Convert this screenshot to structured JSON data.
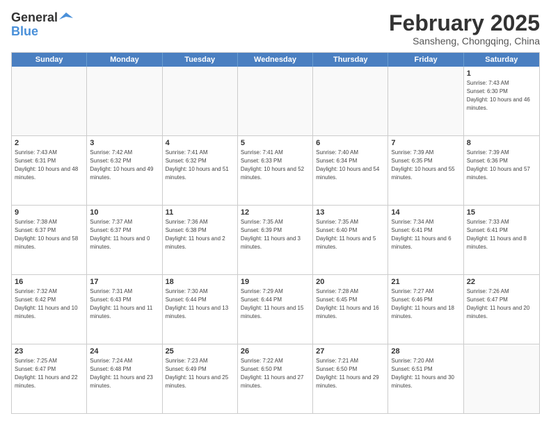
{
  "header": {
    "logo_line1": "General",
    "logo_line2": "Blue",
    "month_title": "February 2025",
    "subtitle": "Sansheng, Chongqing, China"
  },
  "weekdays": [
    "Sunday",
    "Monday",
    "Tuesday",
    "Wednesday",
    "Thursday",
    "Friday",
    "Saturday"
  ],
  "rows": [
    [
      {
        "day": "",
        "text": ""
      },
      {
        "day": "",
        "text": ""
      },
      {
        "day": "",
        "text": ""
      },
      {
        "day": "",
        "text": ""
      },
      {
        "day": "",
        "text": ""
      },
      {
        "day": "",
        "text": ""
      },
      {
        "day": "1",
        "text": "Sunrise: 7:43 AM\nSunset: 6:30 PM\nDaylight: 10 hours and 46 minutes."
      }
    ],
    [
      {
        "day": "2",
        "text": "Sunrise: 7:43 AM\nSunset: 6:31 PM\nDaylight: 10 hours and 48 minutes."
      },
      {
        "day": "3",
        "text": "Sunrise: 7:42 AM\nSunset: 6:32 PM\nDaylight: 10 hours and 49 minutes."
      },
      {
        "day": "4",
        "text": "Sunrise: 7:41 AM\nSunset: 6:32 PM\nDaylight: 10 hours and 51 minutes."
      },
      {
        "day": "5",
        "text": "Sunrise: 7:41 AM\nSunset: 6:33 PM\nDaylight: 10 hours and 52 minutes."
      },
      {
        "day": "6",
        "text": "Sunrise: 7:40 AM\nSunset: 6:34 PM\nDaylight: 10 hours and 54 minutes."
      },
      {
        "day": "7",
        "text": "Sunrise: 7:39 AM\nSunset: 6:35 PM\nDaylight: 10 hours and 55 minutes."
      },
      {
        "day": "8",
        "text": "Sunrise: 7:39 AM\nSunset: 6:36 PM\nDaylight: 10 hours and 57 minutes."
      }
    ],
    [
      {
        "day": "9",
        "text": "Sunrise: 7:38 AM\nSunset: 6:37 PM\nDaylight: 10 hours and 58 minutes."
      },
      {
        "day": "10",
        "text": "Sunrise: 7:37 AM\nSunset: 6:37 PM\nDaylight: 11 hours and 0 minutes."
      },
      {
        "day": "11",
        "text": "Sunrise: 7:36 AM\nSunset: 6:38 PM\nDaylight: 11 hours and 2 minutes."
      },
      {
        "day": "12",
        "text": "Sunrise: 7:35 AM\nSunset: 6:39 PM\nDaylight: 11 hours and 3 minutes."
      },
      {
        "day": "13",
        "text": "Sunrise: 7:35 AM\nSunset: 6:40 PM\nDaylight: 11 hours and 5 minutes."
      },
      {
        "day": "14",
        "text": "Sunrise: 7:34 AM\nSunset: 6:41 PM\nDaylight: 11 hours and 6 minutes."
      },
      {
        "day": "15",
        "text": "Sunrise: 7:33 AM\nSunset: 6:41 PM\nDaylight: 11 hours and 8 minutes."
      }
    ],
    [
      {
        "day": "16",
        "text": "Sunrise: 7:32 AM\nSunset: 6:42 PM\nDaylight: 11 hours and 10 minutes."
      },
      {
        "day": "17",
        "text": "Sunrise: 7:31 AM\nSunset: 6:43 PM\nDaylight: 11 hours and 11 minutes."
      },
      {
        "day": "18",
        "text": "Sunrise: 7:30 AM\nSunset: 6:44 PM\nDaylight: 11 hours and 13 minutes."
      },
      {
        "day": "19",
        "text": "Sunrise: 7:29 AM\nSunset: 6:44 PM\nDaylight: 11 hours and 15 minutes."
      },
      {
        "day": "20",
        "text": "Sunrise: 7:28 AM\nSunset: 6:45 PM\nDaylight: 11 hours and 16 minutes."
      },
      {
        "day": "21",
        "text": "Sunrise: 7:27 AM\nSunset: 6:46 PM\nDaylight: 11 hours and 18 minutes."
      },
      {
        "day": "22",
        "text": "Sunrise: 7:26 AM\nSunset: 6:47 PM\nDaylight: 11 hours and 20 minutes."
      }
    ],
    [
      {
        "day": "23",
        "text": "Sunrise: 7:25 AM\nSunset: 6:47 PM\nDaylight: 11 hours and 22 minutes."
      },
      {
        "day": "24",
        "text": "Sunrise: 7:24 AM\nSunset: 6:48 PM\nDaylight: 11 hours and 23 minutes."
      },
      {
        "day": "25",
        "text": "Sunrise: 7:23 AM\nSunset: 6:49 PM\nDaylight: 11 hours and 25 minutes."
      },
      {
        "day": "26",
        "text": "Sunrise: 7:22 AM\nSunset: 6:50 PM\nDaylight: 11 hours and 27 minutes."
      },
      {
        "day": "27",
        "text": "Sunrise: 7:21 AM\nSunset: 6:50 PM\nDaylight: 11 hours and 29 minutes."
      },
      {
        "day": "28",
        "text": "Sunrise: 7:20 AM\nSunset: 6:51 PM\nDaylight: 11 hours and 30 minutes."
      },
      {
        "day": "",
        "text": ""
      }
    ]
  ]
}
